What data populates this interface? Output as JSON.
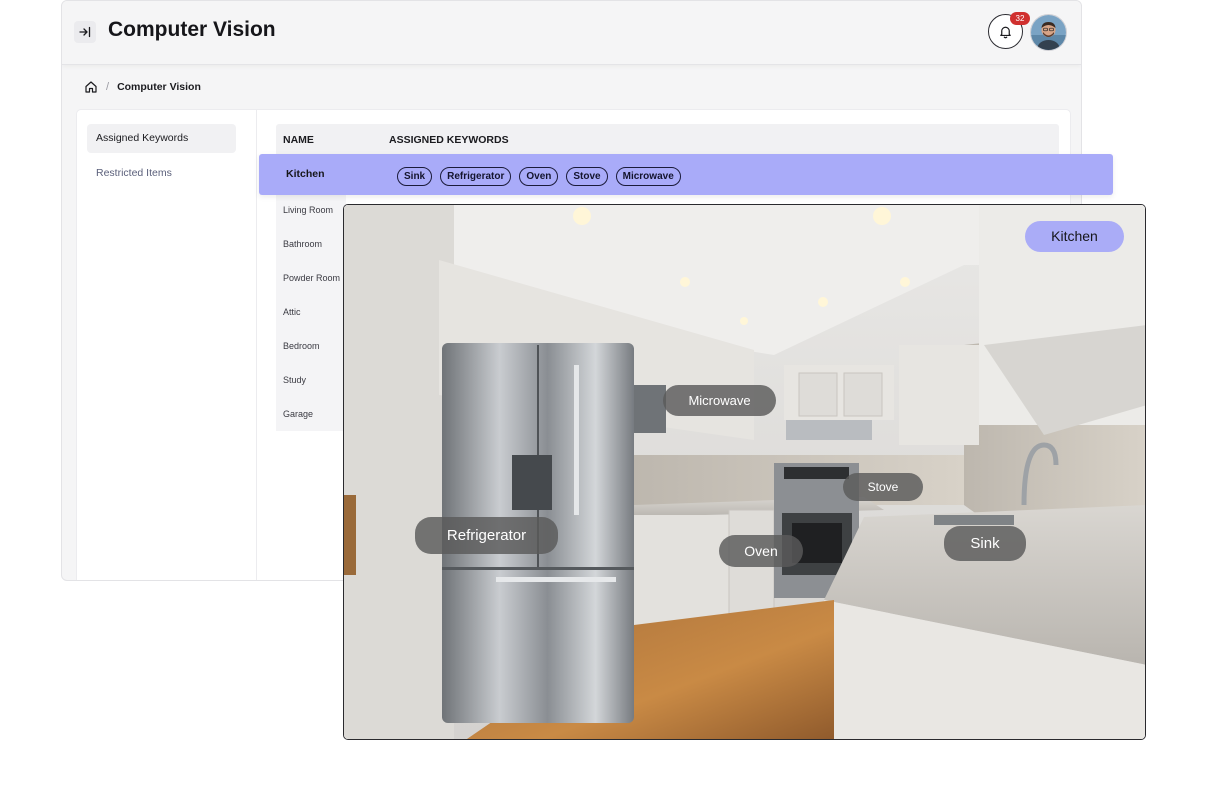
{
  "header": {
    "title": "Computer Vision",
    "notification_count": "32"
  },
  "breadcrumb": {
    "current": "Computer Vision",
    "separator": "/"
  },
  "sidebar": {
    "items": [
      {
        "label": "Assigned Keywords"
      },
      {
        "label": "Restricted Items"
      }
    ]
  },
  "table": {
    "columns": [
      "NAME",
      "ASSIGNED KEYWORDS"
    ],
    "selected": {
      "name": "Kitchen",
      "keywords": [
        "Sink",
        "Refrigerator",
        "Oven",
        "Stove",
        "Microwave"
      ]
    },
    "rows": [
      "Living Room",
      "Bathroom",
      "Powder Room",
      "Attic",
      "Bedroom",
      "Study",
      "Garage"
    ]
  },
  "photo": {
    "scene_label": "Kitchen",
    "tags": [
      "Microwave",
      "Stove",
      "Refrigerator",
      "Oven",
      "Sink"
    ]
  },
  "colors": {
    "accent": "#a9abf9",
    "badge": "#d0302f"
  },
  "icons": {
    "collapse": "arrow-to-right-icon",
    "bell": "bell-icon",
    "home": "home-icon"
  }
}
